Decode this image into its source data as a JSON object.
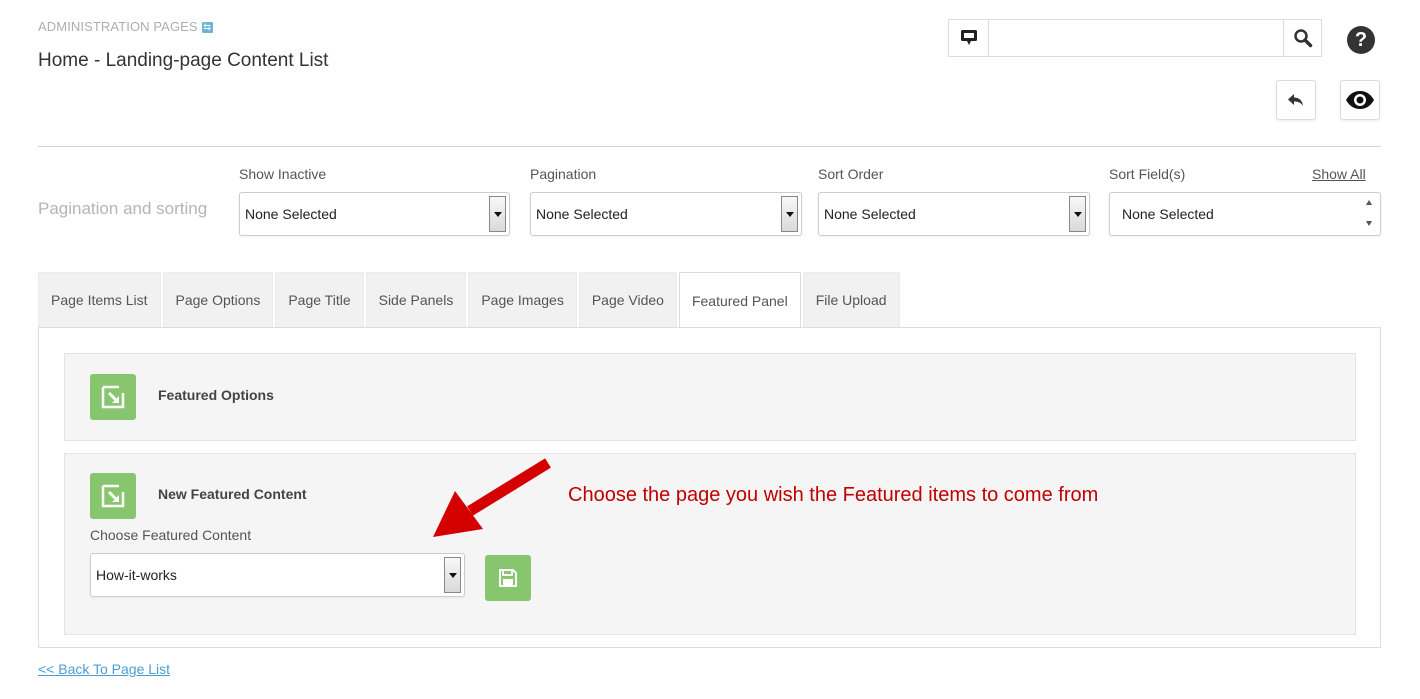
{
  "header": {
    "section_label": "ADMINISTRATION PAGES",
    "section_badge": "⇆",
    "page_title": "Home - Landing-page Content List"
  },
  "search": {
    "value": "",
    "placeholder": ""
  },
  "help_label": "?",
  "sorting": {
    "section_label": "Pagination and sorting",
    "show_all": "Show All",
    "fields": [
      {
        "label": "Show Inactive",
        "value": "None Selected"
      },
      {
        "label": "Pagination",
        "value": "None Selected"
      },
      {
        "label": "Sort Order",
        "value": "None Selected"
      },
      {
        "label": "Sort Field(s)",
        "value": "None Selected"
      }
    ]
  },
  "tabs": [
    {
      "label": "Page Items List"
    },
    {
      "label": "Page Options"
    },
    {
      "label": "Page Title"
    },
    {
      "label": "Side Panels"
    },
    {
      "label": "Page Images"
    },
    {
      "label": "Page Video"
    },
    {
      "label": "Featured Panel",
      "active": true
    },
    {
      "label": "File Upload"
    }
  ],
  "featured_options": {
    "title": "Featured Options"
  },
  "new_featured": {
    "title": "New Featured Content",
    "field_label": "Choose Featured Content",
    "selected": "How-it-works"
  },
  "annotation": "Choose the page you wish the Featured items to come from",
  "back_link": "<< Back To Page List",
  "colors": {
    "accent_green": "#87c66f",
    "annotation_red": "#c00000",
    "link_blue": "#4a9cd6"
  },
  "icons": [
    "monitor-icon",
    "search-icon",
    "help-icon",
    "undo-icon",
    "eye-icon",
    "edit-icon",
    "save-icon",
    "arrow-annotation"
  ]
}
